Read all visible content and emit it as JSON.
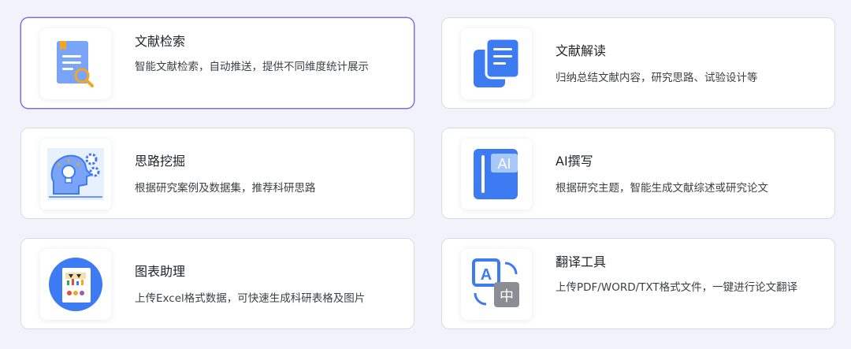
{
  "cards": [
    {
      "title": "文献检索",
      "desc": "智能文献检索，自动推送，提供不同维度统计展示",
      "icon": "document-search-icon"
    },
    {
      "title": "文献解读",
      "desc": "归纳总结文献内容，研究思路、试验设计等",
      "icon": "documents-copy-icon"
    },
    {
      "title": "思路挖掘",
      "desc": "根据研究案例及数据集，推荐科研思路",
      "icon": "brain-gears-icon"
    },
    {
      "title": "AI撰写",
      "desc": "根据研究主题，智能生成文献综述或研究论文",
      "icon": "ai-notebook-icon",
      "icon_text": "AI"
    },
    {
      "title": "图表助理",
      "desc": "上传Excel格式数据，可快速生成科研表格及图片",
      "icon": "chart-board-icon"
    },
    {
      "title": "翻译工具",
      "desc": "上传PDF/WORD/TXT格式文件，一键进行论文翻译",
      "icon": "translate-icon",
      "icon_text_a": "A",
      "icon_text_b": "中"
    }
  ],
  "colors": {
    "accent": "#7b6ff0",
    "icon_blue": "#3d7bf2",
    "icon_light_blue": "#7aa4f7",
    "icon_orange": "#f5a524"
  }
}
